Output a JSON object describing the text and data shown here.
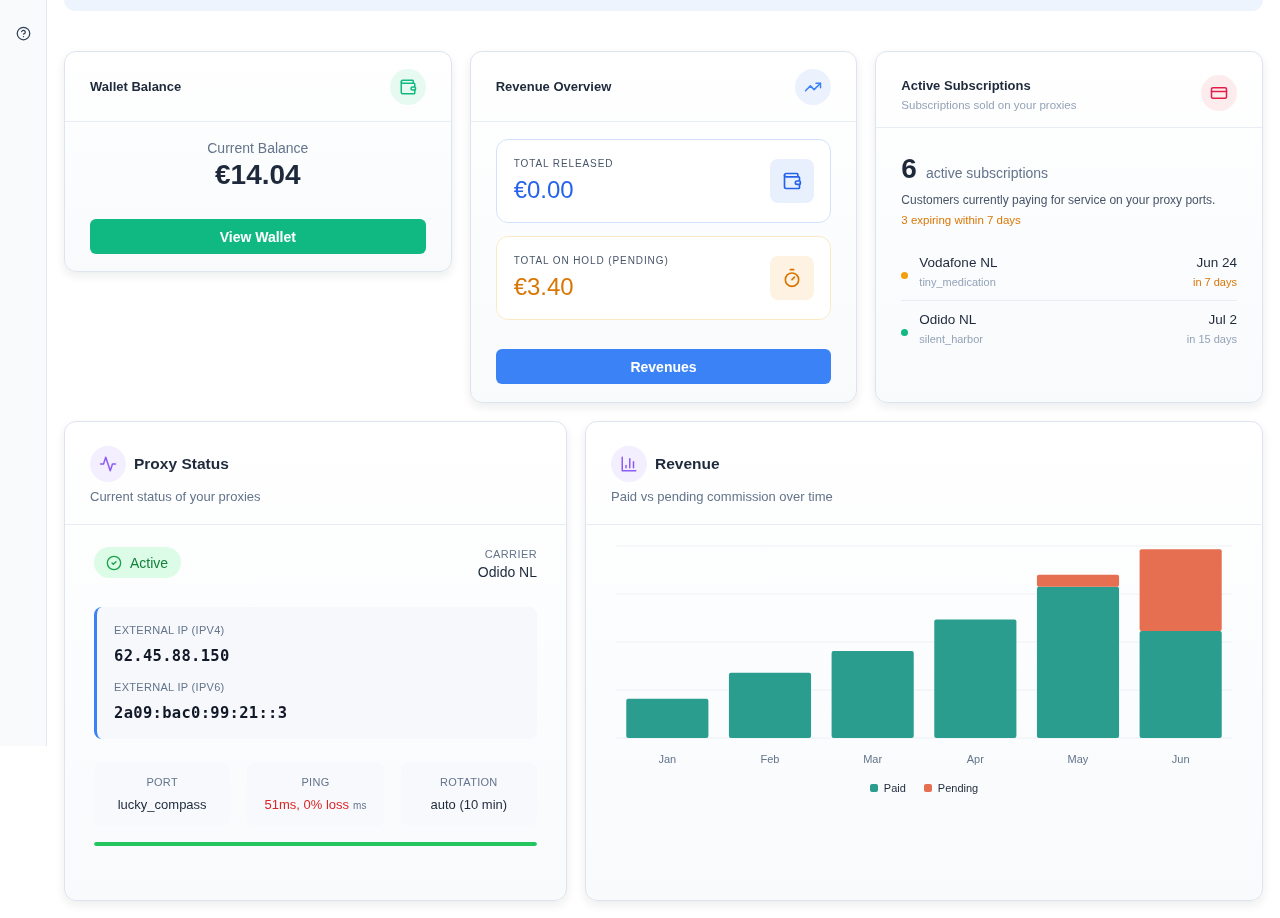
{
  "wallet_balance": {
    "title": "Wallet Balance",
    "label": "Current Balance",
    "amount": "€14.04",
    "button": "View Wallet"
  },
  "revenue_overview": {
    "title": "Revenue Overview",
    "stats": [
      {
        "kind": "released",
        "label": "TOTAL RELEASED",
        "amount": "€0.00"
      },
      {
        "kind": "pending",
        "label": "TOTAL ON HOLD (PENDING)",
        "amount": "€3.40"
      }
    ],
    "button": "Revenues"
  },
  "active_subscriptions": {
    "title": "Active Subscriptions",
    "subtitle": "Subscriptions sold on your proxies",
    "count": "6",
    "count_label": "active subscriptions",
    "description": "Customers currently paying for service on your proxy ports.",
    "expiring_note": "3 expiring within 7 days",
    "items": [
      {
        "carrier": "Vodafone NL",
        "port": "tiny_medication",
        "date": "Jun 24",
        "relative": "in 7 days",
        "expiring_soon": true,
        "color": "#f59e0b"
      },
      {
        "carrier": "Odido NL",
        "port": "silent_harbor",
        "date": "Jul 2",
        "relative": "in 15 days",
        "expiring_soon": false,
        "color": "#10b981"
      }
    ]
  },
  "proxy_status": {
    "title": "Proxy Status",
    "subtitle": "Current status of your proxies",
    "status": {
      "label": "Active",
      "active": true
    },
    "carrier": {
      "label": "CARRIER",
      "value": "Odido NL"
    },
    "addresses": [
      {
        "label": "EXTERNAL IP (IPV4)",
        "value": "62.45.88.150"
      },
      {
        "label": "EXTERNAL IP (IPV6)",
        "value": "2a09:bac0:99:21::3"
      }
    ],
    "stats": [
      {
        "label": "PORT",
        "value": "lucky_compass",
        "alert": false
      },
      {
        "label": "PING",
        "value": "51ms, 0% loss",
        "unit": "ms",
        "alert": true
      },
      {
        "label": "ROTATION",
        "value": "auto (10 min)",
        "alert": false
      }
    ],
    "health_bar": {
      "level": 1
    }
  },
  "revenue": {
    "title": "Revenue",
    "subtitle": "Paid vs pending commission over time",
    "months": [
      "Jan",
      "Feb",
      "Mar",
      "Apr",
      "May",
      "Jun"
    ],
    "legend": [
      {
        "name": "Paid",
        "color": "#2a9d8f"
      },
      {
        "name": "Pending",
        "color": "#e76f51"
      }
    ]
  }
}
